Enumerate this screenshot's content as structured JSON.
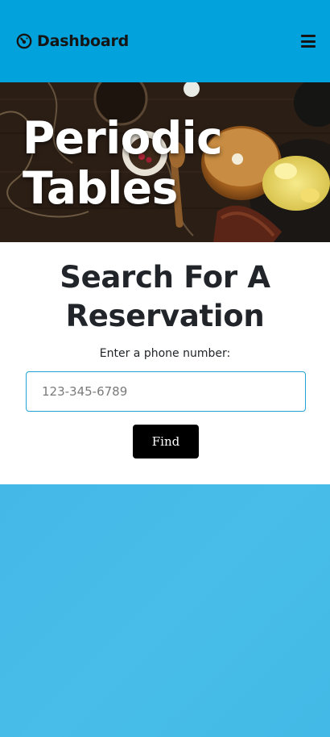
{
  "navbar": {
    "brand_label": "Dashboard",
    "brand_icon": "gauge-icon",
    "menu_icon": "hamburger-menu-icon",
    "background_color": "#02a3dd"
  },
  "hero": {
    "title_line1": "Periodic",
    "title_line2": "Tables",
    "background_image": "breakfast-table-photo"
  },
  "search": {
    "heading_line1": "Search For A",
    "heading_line2": "Reservation",
    "label": "Enter a phone number:",
    "input_value": "",
    "input_placeholder": "123-345-6789",
    "button_label": "Find"
  },
  "colors": {
    "accent": "#02a3dd",
    "footer": "#45bbe8",
    "button": "#000000"
  }
}
